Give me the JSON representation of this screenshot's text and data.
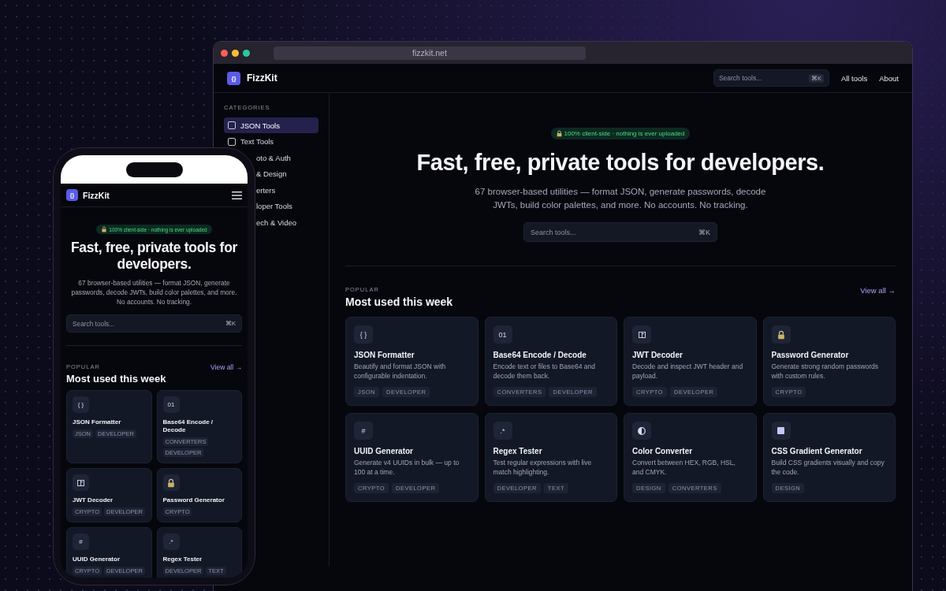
{
  "browser": {
    "url": "fizzkit.net",
    "header": {
      "logo_mark": "{}",
      "brand": "FizzKit",
      "search": {
        "placeholder": "Search tools...",
        "shortcut": "⌘K"
      },
      "links": [
        "All tools",
        "About"
      ]
    },
    "sidebar": {
      "heading": "CATEGORIES",
      "items": [
        {
          "label": "JSON Tools",
          "selected": true,
          "covered": false
        },
        {
          "label": "Text Tools",
          "selected": false,
          "covered": false
        },
        {
          "label": "oto & Auth",
          "selected": false,
          "covered": true
        },
        {
          "label": "& Design",
          "selected": false,
          "covered": true
        },
        {
          "label": "erters",
          "selected": false,
          "covered": true
        },
        {
          "label": "loper Tools",
          "selected": false,
          "covered": true
        },
        {
          "label": "ech & Video",
          "selected": false,
          "covered": true
        }
      ]
    },
    "hero": {
      "badge": "100% client-side · nothing is ever uploaded",
      "title": "Fast, free, private tools for developers.",
      "subtitle": "67 browser-based utilities — format JSON, generate passwords, decode JWTs, build color palettes, and more. No accounts. No tracking.",
      "search": {
        "placeholder": "Search tools...",
        "shortcut": "⌘K"
      }
    },
    "popular": {
      "eyebrow": "POPULAR",
      "title": "Most used this week",
      "view_all": "View all →",
      "cards": [
        {
          "icon": {
            "kind": "text",
            "text": "{ }"
          },
          "title": "JSON Formatter",
          "description": "Beautify and format JSON with configurable indentation.",
          "tags": [
            "JSON",
            "DEVELOPER"
          ]
        },
        {
          "icon": {
            "kind": "text",
            "text": "01"
          },
          "title": "Base64 Encode / Decode",
          "description": "Encode text or files to Base64 and decode them back.",
          "tags": [
            "CONVERTERS",
            "DEVELOPER"
          ]
        },
        {
          "icon": {
            "kind": "panel"
          },
          "title": "JWT Decoder",
          "description": "Decode and inspect JWT header and payload.",
          "tags": [
            "CRYPTO",
            "DEVELOPER"
          ]
        },
        {
          "icon": {
            "kind": "lock"
          },
          "title": "Password Generator",
          "description": "Generate strong random passwords with custom rules.",
          "tags": [
            "CRYPTO"
          ]
        },
        {
          "icon": {
            "kind": "text",
            "text": "#"
          },
          "title": "UUID Generator",
          "description": "Generate v4 UUIDs in bulk — up to 100 at a time.",
          "tags": [
            "CRYPTO",
            "DEVELOPER"
          ]
        },
        {
          "icon": {
            "kind": "text",
            "text": ".*"
          },
          "title": "Regex Tester",
          "description": "Test regular expressions with live match highlighting.",
          "tags": [
            "DEVELOPER",
            "TEXT"
          ]
        },
        {
          "icon": {
            "kind": "contrast"
          },
          "title": "Color Converter",
          "description": "Convert between HEX, RGB, HSL, and CMYK.",
          "tags": [
            "DESIGN",
            "CONVERTERS"
          ]
        },
        {
          "icon": {
            "kind": "square"
          },
          "title": "CSS Gradient Generator",
          "description": "Build CSS gradients visually and copy the code.",
          "tags": [
            "DESIGN"
          ]
        }
      ]
    }
  },
  "phone": {
    "header": {
      "logo_mark": "{}",
      "brand": "FizzKit"
    },
    "hero": {
      "badge": "100% client-side · nothing is ever uploaded",
      "title": "Fast, free, private tools for developers.",
      "subtitle": "67 browser-based utilities — format JSON, generate passwords, decode JWTs, build color palettes, and more. No accounts. No tracking.",
      "search": {
        "placeholder": "Search tools...",
        "shortcut": "⌘K"
      }
    },
    "popular": {
      "eyebrow": "POPULAR",
      "title": "Most used this week",
      "view_all": "View all →",
      "cards": [
        {
          "icon": {
            "kind": "text",
            "text": "{ }"
          },
          "title": "JSON Formatter",
          "tags": [
            "JSON",
            "DEVELOPER"
          ]
        },
        {
          "icon": {
            "kind": "text",
            "text": "01"
          },
          "title": "Base64 Encode / Decode",
          "tags": [
            "CONVERTERS",
            "DEVELOPER"
          ]
        },
        {
          "icon": {
            "kind": "panel"
          },
          "title": "JWT Decoder",
          "tags": [
            "CRYPTO",
            "DEVELOPER"
          ]
        },
        {
          "icon": {
            "kind": "lock"
          },
          "title": "Password Generator",
          "tags": [
            "CRYPTO"
          ]
        },
        {
          "icon": {
            "kind": "text",
            "text": "#"
          },
          "title": "UUID Generator",
          "tags": [
            "CRYPTO",
            "DEVELOPER"
          ]
        },
        {
          "icon": {
            "kind": "text",
            "text": ".*"
          },
          "title": "Regex Tester",
          "tags": [
            "DEVELOPER",
            "TEXT"
          ]
        }
      ]
    }
  }
}
